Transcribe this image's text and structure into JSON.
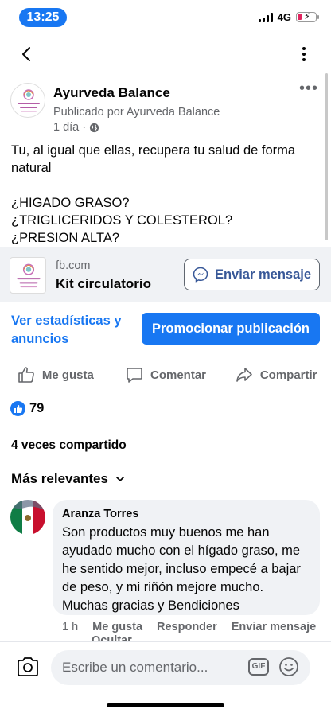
{
  "status_bar": {
    "time": "13:25",
    "network": "4G"
  },
  "icons": {
    "back": "chevron-left-icon",
    "more": "vertical-dots-icon",
    "globe": "globe-icon",
    "messenger": "messenger-icon",
    "like": "thumbs-up-icon",
    "comment": "comment-icon",
    "share": "share-icon",
    "camera": "camera-icon",
    "emoji": "smiley-icon"
  },
  "post": {
    "page_name": "Ayurveda Balance",
    "published_by": "Publicado por Ayurveda Balance",
    "time": "1 día ·",
    "text_lines": [
      "Tu, al igual que ellas, recupera tu salud de forma natural",
      "",
      "¿HIGADO GRASO?",
      "¿TRIGLICERIDOS Y COLESTEROL?",
      "¿PRESION ALTA?"
    ]
  },
  "link_card": {
    "domain": "fb.com",
    "title": "Kit circulatorio",
    "button_label": "Enviar mensaje"
  },
  "stats": {
    "link_label": "Ver estadísticas y anuncios",
    "promote_label": "Promocionar publicación"
  },
  "actions": {
    "like": "Me gusta",
    "comment": "Comentar",
    "share": "Compartir"
  },
  "reactions": {
    "count": "79"
  },
  "shares": "4 veces compartido",
  "sort_label": "Más relevantes",
  "comment": {
    "author": "Aranza Torres",
    "text": "Son productos muy buenos me han ayudado mucho con el hígado graso, me he sentido mejor, incluso empecé a bajar de peso, y mi riñón mejore mucho. Muchas gracias y Bendiciones",
    "time": "1 h",
    "like": "Me gusta",
    "reply": "Responder",
    "send": "Enviar mensaje",
    "hide": "Ocultar"
  },
  "composer": {
    "placeholder": "Escribe un comentario...",
    "gif": "GIF"
  },
  "colors": {
    "brand_blue": "#1877f2",
    "text_secondary": "#65676b",
    "bubble_bg": "#f0f2f5"
  }
}
